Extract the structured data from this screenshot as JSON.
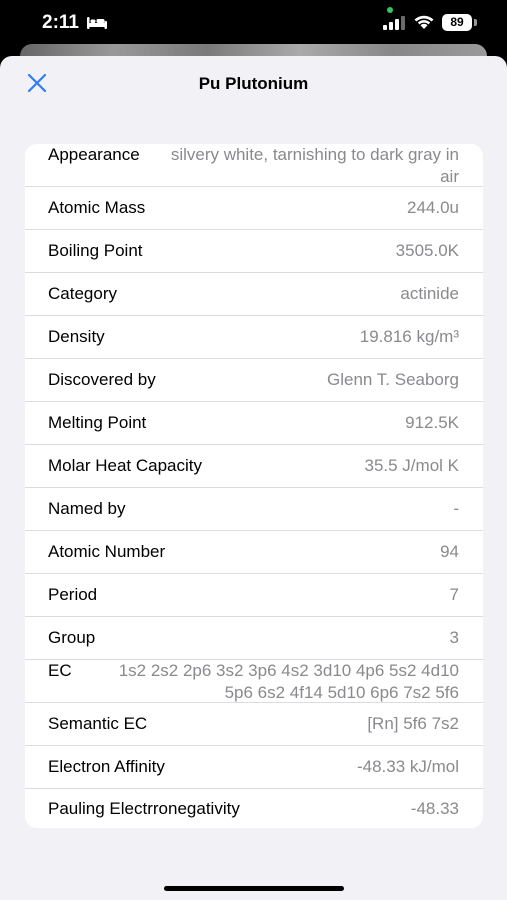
{
  "status_bar": {
    "time": "2:11",
    "battery": "89"
  },
  "sheet": {
    "title": "Pu Plutonium"
  },
  "properties": [
    {
      "label": "Appearance",
      "value": "silvery white, tarnishing to dark gray in air"
    },
    {
      "label": "Atomic Mass",
      "value": "244.0u"
    },
    {
      "label": "Boiling Point",
      "value": "3505.0K"
    },
    {
      "label": "Category",
      "value": "actinide"
    },
    {
      "label": "Density",
      "value": "19.816 kg/m³"
    },
    {
      "label": "Discovered by",
      "value": "Glenn T. Seaborg"
    },
    {
      "label": "Melting Point",
      "value": "912.5K"
    },
    {
      "label": "Molar Heat Capacity",
      "value": "35.5 J/mol K"
    },
    {
      "label": "Named by",
      "value": "-"
    },
    {
      "label": "Atomic Number",
      "value": "94"
    },
    {
      "label": "Period",
      "value": "7"
    },
    {
      "label": "Group",
      "value": "3"
    },
    {
      "label": "EC",
      "value": "1s2 2s2 2p6 3s2 3p6 4s2 3d10 4p6 5s2 4d10 5p6 6s2 4f14 5d10 6p6 7s2 5f6"
    },
    {
      "label": "Semantic EC",
      "value": "[Rn] 5f6 7s2"
    },
    {
      "label": "Electron Affinity",
      "value": "-48.33 kJ/mol"
    },
    {
      "label": "Pauling Electrronegativity",
      "value": "-48.33"
    }
  ]
}
